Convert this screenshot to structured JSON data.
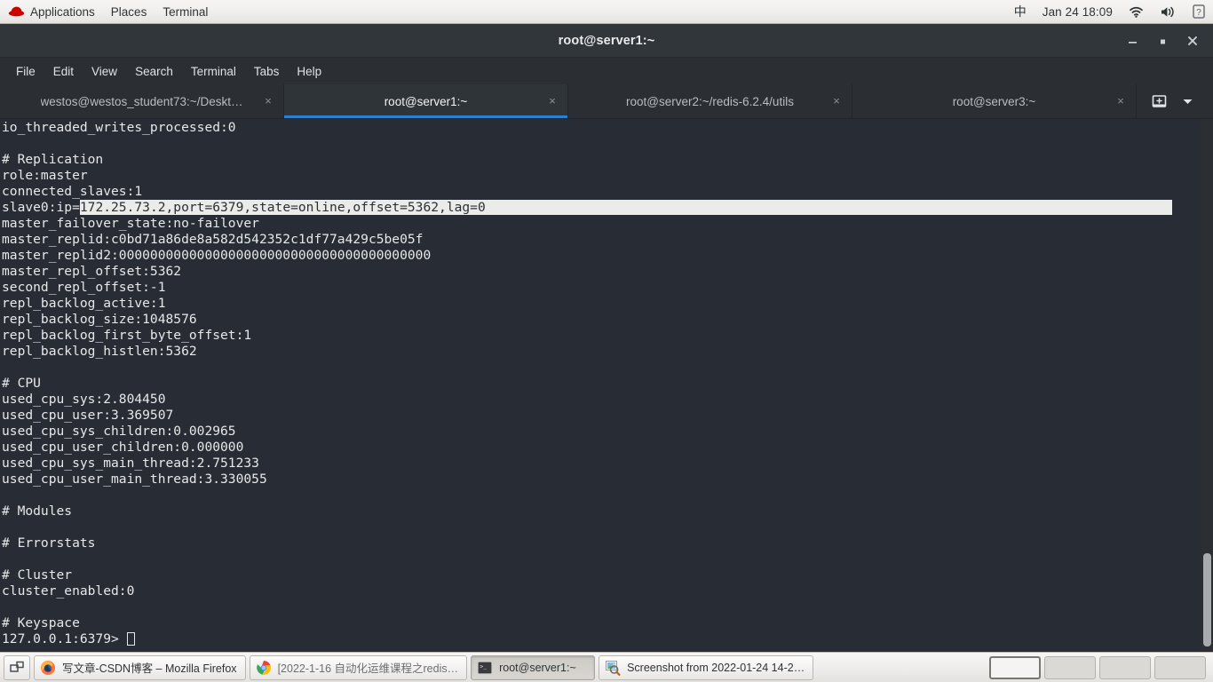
{
  "top_panel": {
    "logo_icon": "redhat-logo-icon",
    "menus": [
      "Applications",
      "Places",
      "Terminal"
    ],
    "ime_indicator": "中",
    "clock": "Jan 24  18:09",
    "indicators": [
      "wifi-icon",
      "volume-icon",
      "help-icon"
    ]
  },
  "window": {
    "title": "root@server1:~",
    "minimize_label": "—",
    "maximize_label": "■",
    "close_label": "✕"
  },
  "menubar": {
    "items": [
      "File",
      "Edit",
      "View",
      "Search",
      "Terminal",
      "Tabs",
      "Help"
    ]
  },
  "tabs": {
    "items": [
      {
        "label": "westos@westos_student73:~/Deskt…",
        "active": false,
        "close_label": "×"
      },
      {
        "label": "root@server1:~",
        "active": true,
        "close_label": "×"
      },
      {
        "label": "root@server2:~/redis-6.2.4/utils",
        "active": false,
        "close_label": "×"
      },
      {
        "label": "root@server3:~",
        "active": false,
        "close_label": "×"
      }
    ],
    "new_tab_icon": "new-tab-icon",
    "tab_list_icon": "chevron-down-icon",
    "active_underline_color": "#2f7fd0"
  },
  "terminal": {
    "prompt": "127.0.0.1:6379>",
    "selection_color": "#ebebe9",
    "background_color": "#282c34",
    "foreground_color": "#e6e8ea",
    "lines": [
      {
        "text": "io_threaded_writes_processed:0"
      },
      {
        "text": ""
      },
      {
        "text": "# Replication"
      },
      {
        "text": "role:master"
      },
      {
        "text": "connected_slaves:1"
      },
      {
        "text": "slave0:ip=",
        "selected_text": "172.25.73.2,port=6379,state=online,offset=5362,lag=0",
        "selected_to_eol": true
      },
      {
        "text": "master_failover_state:no-failover"
      },
      {
        "text": "master_replid:c0bd71a86de8a582d542352c1df77a429c5be05f"
      },
      {
        "text": "master_replid2:0000000000000000000000000000000000000000"
      },
      {
        "text": "master_repl_offset:5362"
      },
      {
        "text": "second_repl_offset:-1"
      },
      {
        "text": "repl_backlog_active:1"
      },
      {
        "text": "repl_backlog_size:1048576"
      },
      {
        "text": "repl_backlog_first_byte_offset:1"
      },
      {
        "text": "repl_backlog_histlen:5362"
      },
      {
        "text": ""
      },
      {
        "text": "# CPU"
      },
      {
        "text": "used_cpu_sys:2.804450"
      },
      {
        "text": "used_cpu_user:3.369507"
      },
      {
        "text": "used_cpu_sys_children:0.002965"
      },
      {
        "text": "used_cpu_user_children:0.000000"
      },
      {
        "text": "used_cpu_sys_main_thread:2.751233"
      },
      {
        "text": "used_cpu_user_main_thread:3.330055"
      },
      {
        "text": ""
      },
      {
        "text": "# Modules"
      },
      {
        "text": ""
      },
      {
        "text": "# Errorstats"
      },
      {
        "text": ""
      },
      {
        "text": "# Cluster"
      },
      {
        "text": "cluster_enabled:0"
      },
      {
        "text": ""
      },
      {
        "text": "# Keyspace"
      },
      {
        "text": "127.0.0.1:6379> ",
        "cursor": true
      }
    ]
  },
  "taskbar": {
    "show_desktop_icon": "show-desktop-icon",
    "items": [
      {
        "label": "写文章-CSDN博客 – Mozilla Firefox",
        "icon": "firefox-icon",
        "state": "normal"
      },
      {
        "label": "[2022-1-16 自动化运维课程之redis…",
        "icon": "chrome-icon",
        "state": "inactive"
      },
      {
        "label": "root@server1:~",
        "icon": "terminal-icon",
        "state": "active"
      },
      {
        "label": "Screenshot from 2022-01-24 14-2…",
        "icon": "image-viewer-icon",
        "state": "normal"
      }
    ],
    "workspaces": [
      {
        "active": true
      },
      {
        "active": false
      },
      {
        "active": false
      },
      {
        "active": false
      }
    ]
  }
}
